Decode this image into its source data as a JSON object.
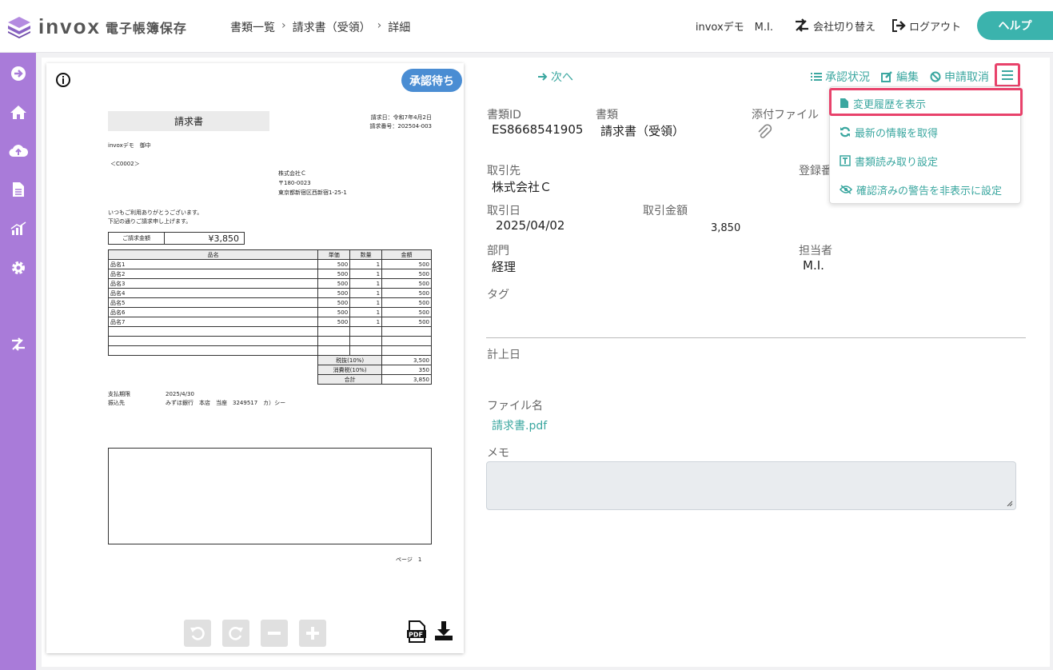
{
  "app": {
    "logo_text": "invox",
    "logo_sub": "電子帳簿保存"
  },
  "breadcrumb": {
    "items": [
      "書類一覧",
      "請求書（受領）",
      "詳細"
    ],
    "separator": "›"
  },
  "header": {
    "user": "invoxデモ　M.I.",
    "switch_company": "会社切り替え",
    "logout": "ログアウト",
    "help": "ヘルプ"
  },
  "sidebar": {
    "items": [
      "arrow-right-circle-icon",
      "home-icon",
      "cloud-upload-icon",
      "document-icon",
      "chart-icon",
      "gear-icon",
      "switch-icon"
    ]
  },
  "preview": {
    "status": "承認待ち",
    "document": {
      "title": "請求書",
      "issue_date": "請求日：令和7年4月2日",
      "invoice_no": "請求番号：202504-003",
      "addressee": "invoxデモ　御中",
      "customer_code": "＜C0002＞",
      "issuer_name": "株式会社Ｃ",
      "issuer_zip": "〒180-0023",
      "issuer_address": "東京都新宿区西新宿1-25-1",
      "greeting_1": "いつもご利用ありがとうございます。",
      "greeting_2": "下記の通りご請求申し上げます。",
      "amount_label": "ご請求金額",
      "amount_value": "¥3,850",
      "columns": [
        "品名",
        "単価",
        "数量",
        "金額"
      ],
      "rows": [
        [
          "品名1",
          "500",
          "1",
          "500"
        ],
        [
          "品名2",
          "500",
          "1",
          "500"
        ],
        [
          "品名3",
          "500",
          "1",
          "500"
        ],
        [
          "品名4",
          "500",
          "1",
          "500"
        ],
        [
          "品名5",
          "500",
          "1",
          "500"
        ],
        [
          "品名6",
          "500",
          "1",
          "500"
        ],
        [
          "品名7",
          "500",
          "1",
          "500"
        ]
      ],
      "subtotal_label": "税抜(10%)",
      "subtotal_value": "3,500",
      "tax_label": "消費税(10%)",
      "tax_value": "350",
      "total_label": "合計",
      "total_value": "3,850",
      "due_label": "支払期限",
      "due_value": "2025/4/30",
      "bank_label": "振込先",
      "bank_value": "みずほ銀行　本店　当座　3249517　カ）シー",
      "page": "ページ　1"
    }
  },
  "toolbar": {
    "next": "次へ",
    "approval_status": "承認状況",
    "edit": "編集",
    "cancel_request": "申請取消"
  },
  "dropdown": {
    "items": [
      "変更履歴を表示",
      "最新の情報を取得",
      "書類読み取り設定",
      "確認済みの警告を非表示に設定"
    ]
  },
  "fields": {
    "doc_id_label": "書類ID",
    "doc_id": "ES8668541905",
    "doc_type_label": "書類",
    "doc_type": "請求書（受領）",
    "attachment_label": "添付ファイル",
    "partner_label": "取引先",
    "partner": "株式会社Ｃ",
    "reg_no_label": "登録番",
    "date_label": "取引日",
    "date": "2025/04/02",
    "amount_label": "取引金額",
    "amount": "3,850",
    "dept_label": "部門",
    "dept": "経理",
    "person_label": "担当者",
    "person": "M.I.",
    "tag_label": "タグ",
    "record_date_label": "計上日",
    "filename_label": "ファイル名",
    "filename": "請求書.pdf",
    "memo_label": "メモ"
  },
  "colors": {
    "accent": "#3ba7a0",
    "sidebar": "#a97bd9",
    "status": "#4a8dd3",
    "highlight": "#e8426b"
  }
}
